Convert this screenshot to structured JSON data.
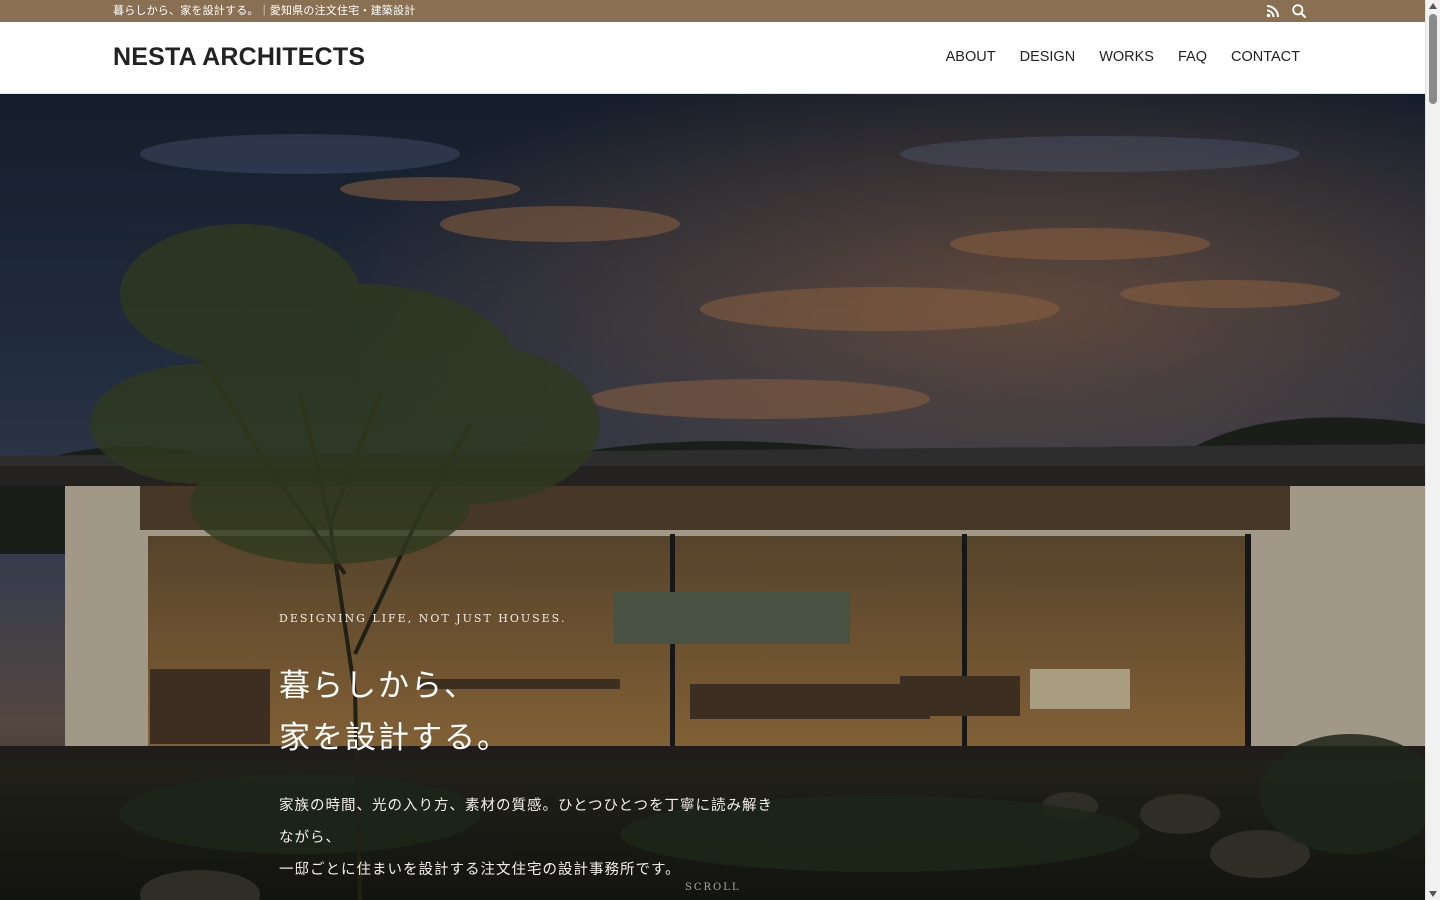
{
  "topbar": {
    "tagline": "暮らしから、家を設計する。｜愛知県の注文住宅・建築設計",
    "bg_color": "#8a7053",
    "icons": [
      "rss-icon",
      "search-icon"
    ]
  },
  "header": {
    "logo": "NESTA ARCHITECTS",
    "nav": [
      {
        "label": "ABOUT"
      },
      {
        "label": "DESIGN"
      },
      {
        "label": "WORKS"
      },
      {
        "label": "FAQ"
      },
      {
        "label": "CONTACT"
      }
    ]
  },
  "hero": {
    "eyebrow": "DESIGNING LIFE, NOT JUST HOUSES.",
    "headline": [
      "暮らしから、",
      "家を設計する。"
    ],
    "lead": [
      "家族の時間、光の入り方、素材の質感。ひとつひとつを丁寧に読み解き",
      "ながら、",
      "一邸ごとに住まいを設計する注文住宅の設計事務所です。"
    ],
    "scroll_label": "SCROLL",
    "image": "dusk-house-photo"
  }
}
